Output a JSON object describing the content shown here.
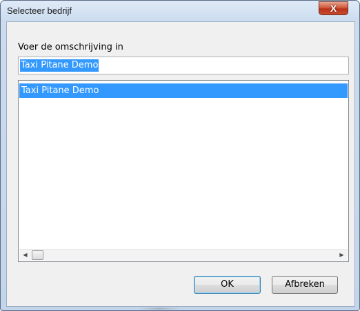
{
  "window": {
    "title": "Selecteer bedrijf",
    "close_label": "X"
  },
  "form": {
    "prompt_label": "Voer de omschrijving in",
    "description_value": "Taxi Pitane Demo",
    "list_items": [
      "Taxi Pitane Demo"
    ],
    "selected_index": 0,
    "scroll_left_glyph": "◀",
    "scroll_right_glyph": "▶"
  },
  "buttons": {
    "ok_label": "OK",
    "cancel_label": "Afbreken"
  },
  "colors": {
    "selection": "#3399ff",
    "close_button": "#c94e30"
  }
}
